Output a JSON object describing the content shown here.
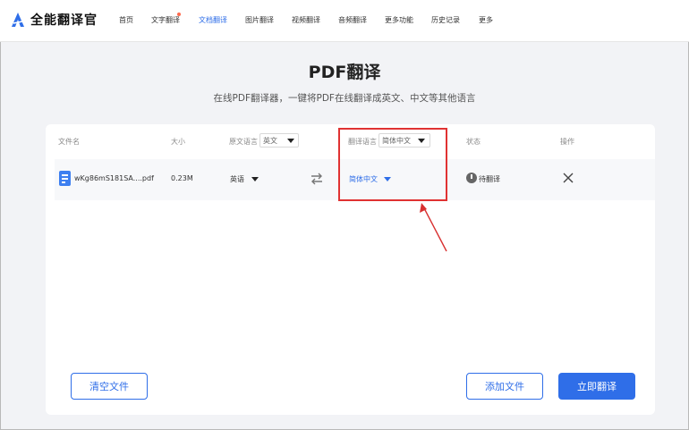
{
  "header": {
    "brand": "全能翻译官",
    "nav": [
      {
        "label": "首页"
      },
      {
        "label": "文字翻译"
      },
      {
        "label": "文档翻译"
      },
      {
        "label": "图片翻译"
      },
      {
        "label": "视频翻译"
      },
      {
        "label": "音频翻译"
      },
      {
        "label": "更多功能"
      },
      {
        "label": "历史记录"
      },
      {
        "label": "更多"
      }
    ],
    "active_index": 2
  },
  "page": {
    "title": "PDF翻译",
    "subtitle": "在线PDF翻译器，一键将PDF在线翻译成英文、中文等其他语言"
  },
  "table": {
    "columns": {
      "file_name": "文件名",
      "size": "大小",
      "source_lang": "原文语言",
      "target_lang": "翻译语言",
      "status": "状态",
      "action": "操作"
    },
    "source_batch_select": "英文",
    "target_batch_select": "简体中文",
    "rows": [
      {
        "file_name": "wKg86mS181SA....pdf",
        "size": "0.23M",
        "source_lang": "英语",
        "target_lang": "简体中文",
        "status": "待翻译"
      }
    ]
  },
  "buttons": {
    "clear": "清空文件",
    "add": "添加文件",
    "translate": "立即翻译"
  },
  "colors": {
    "accent": "#2f6ee8",
    "highlight": "#e03232"
  }
}
